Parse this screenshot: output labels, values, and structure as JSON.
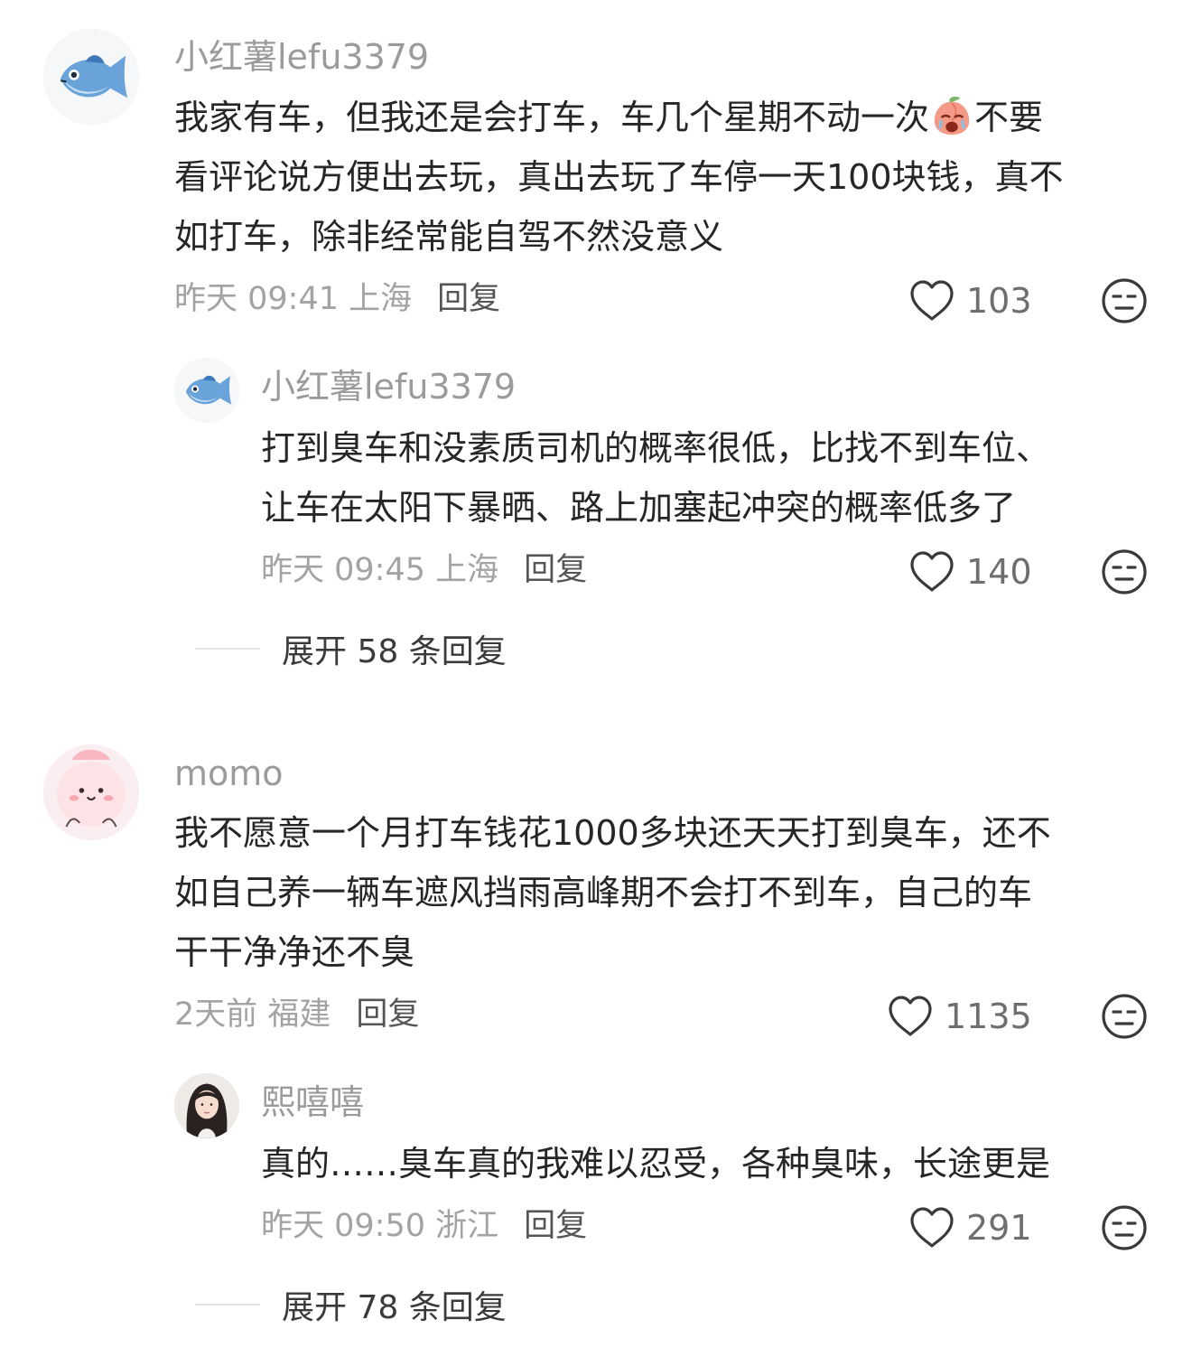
{
  "comments": [
    {
      "username": "小红薯lefu3379",
      "avatar_icon": "fish-icon",
      "text_line1_before_emoji": "我家有车，但我还是会打车，车几个星期不动一次",
      "emoji_icon": "crying-peach-emoji-icon",
      "text_line1_after_emoji": "不要",
      "text_lines": [
        "看评论说方便出去玩，真出去玩了车停一天100块钱，真不",
        "如打车，除非经常能自驾不然没意义"
      ],
      "time_location": "昨天 09:41 上海",
      "reply_label": "回复",
      "likes": "103",
      "replies": [
        {
          "username": "小红薯lefu3379",
          "avatar_icon": "fish-icon",
          "text_lines": [
            "打到臭车和没素质司机的概率很低，比找不到车位、",
            "让车在太阳下暴晒、路上加塞起冲突的概率低多了"
          ],
          "time_location": "昨天 09:45 上海",
          "reply_label": "回复",
          "likes": "140"
        }
      ],
      "expand_label": "展开 58 条回复"
    },
    {
      "username": "momo",
      "avatar_icon": "pink-blob-avatar-icon",
      "text_lines": [
        "我不愿意一个月打车钱花1000多块还天天打到臭车，还不",
        "如自己养一辆车遮风挡雨高峰期不会打不到车，自己的车",
        "干干净净还不臭"
      ],
      "time_location": "2天前 福建",
      "reply_label": "回复",
      "likes": "1135",
      "replies": [
        {
          "username": "熙嘻嘻",
          "avatar_icon": "girl-portrait-avatar-icon",
          "text_lines": [
            "真的……臭车真的我难以忍受，各种臭味，长途更是"
          ],
          "time_location": "昨天 09:50 浙江",
          "reply_label": "回复",
          "likes": "291"
        }
      ],
      "expand_label": "展开 78 条回复"
    }
  ],
  "icons": {
    "like": "heart-outline-icon",
    "dislike": "unamused-face-icon"
  },
  "colors": {
    "username": "#9b9b9b",
    "text": "#262626",
    "meta": "#a3a3a3",
    "icon": "#4a4a4a"
  }
}
